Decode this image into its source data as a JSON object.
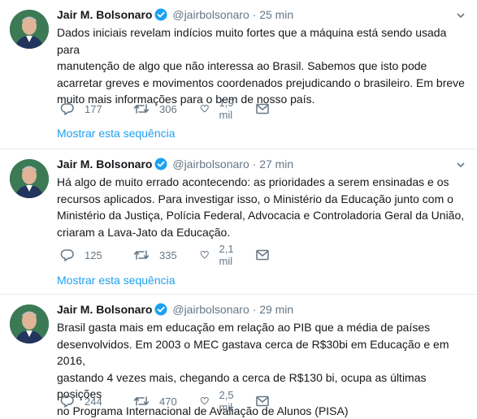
{
  "tweets": [
    {
      "name": "Jair M. Bolsonaro",
      "handle": "@jairbolsonaro",
      "separator": "·",
      "time": "25 min",
      "lines": [
        "Dados iniciais revelam indícios muito fortes que a máquina está sendo usada para",
        "manutenção de algo que não interessa ao Brasil. Sabemos que isto pode",
        "acarretar greves e movimentos coordenados prejudicando o brasileiro. Em breve",
        "muito mais informações para o bem de nosso país."
      ],
      "replies": "177",
      "retweets": "306",
      "likes": "1,9 mil",
      "show_thread": "Mostrar esta sequência"
    },
    {
      "name": "Jair M. Bolsonaro",
      "handle": "@jairbolsonaro",
      "separator": "·",
      "time": "27 min",
      "lines": [
        "Há algo de muito errado acontecendo: as prioridades a serem ensinadas e os",
        "recursos aplicados. Para investigar isso, o Ministério da Educação junto com o",
        "Ministério da Justiça, Polícia Federal, Advocacia e Controladoria Geral da União,",
        "criaram a Lava-Jato da Educação."
      ],
      "replies": "125",
      "retweets": "335",
      "likes": "2,1 mil",
      "show_thread": "Mostrar esta sequência"
    },
    {
      "name": "Jair M. Bolsonaro",
      "handle": "@jairbolsonaro",
      "separator": "·",
      "time": "29 min",
      "lines": [
        "Brasil gasta mais em educação em relação ao PIB que a média de países",
        "desenvolvidos. Em 2003 o MEC gastava cerca de R$30bi em Educação e em 2016,",
        "gastando 4 vezes mais, chegando a cerca de R$130 bi, ocupa as últimas posições",
        "no Programa Internacional de Avaliação de Alunos (PISA)"
      ],
      "replies": "244",
      "retweets": "470",
      "likes": "2,5 mil"
    }
  ],
  "icons": {
    "reply": "reply-icon",
    "retweet": "retweet-icon",
    "like": "heart-icon",
    "message": "envelope-icon",
    "verified": "verified-badge-icon",
    "more": "chevron-down-icon"
  },
  "colors": {
    "link": "#1da1f2",
    "secondary_text": "#657786",
    "divider": "#e6ecf0"
  }
}
